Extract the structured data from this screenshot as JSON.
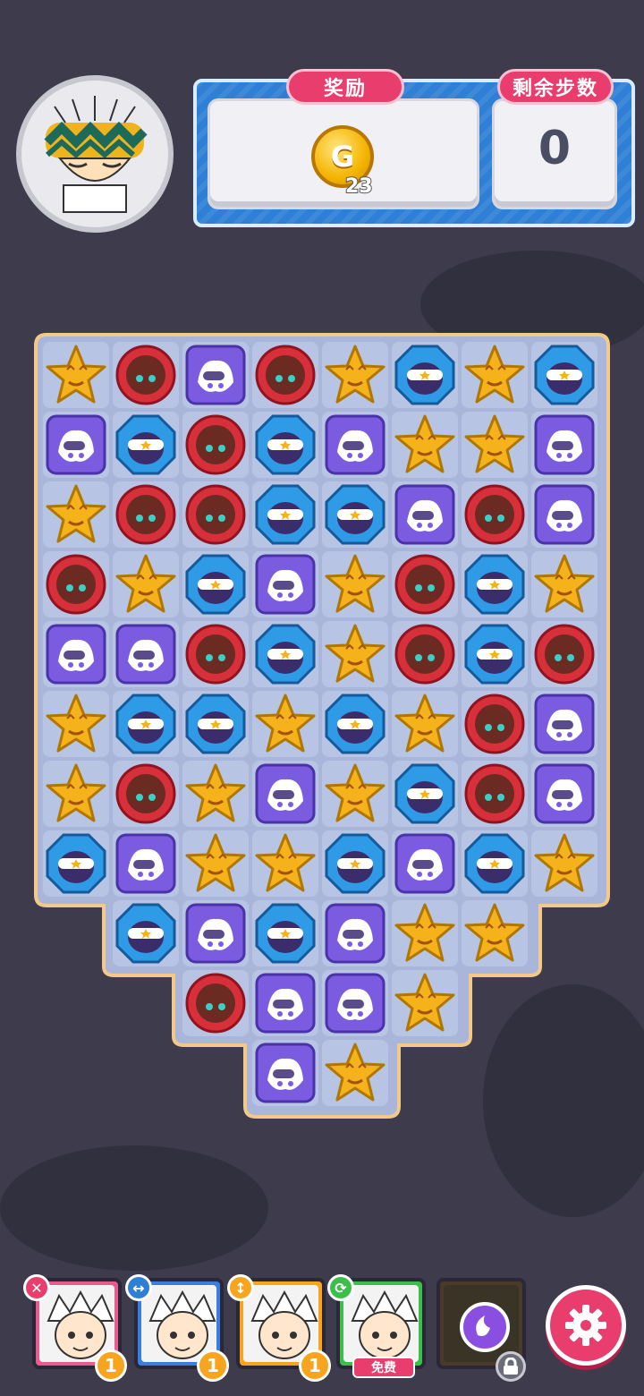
{
  "header": {
    "reward_label": "奖励",
    "reward_coin_icon": "G",
    "reward_amount": "23",
    "steps_label": "剩余步数",
    "steps_value": "0"
  },
  "board": {
    "rows": [
      [
        "star",
        "red",
        "purple",
        "red",
        "star",
        "blue",
        "star",
        "blue"
      ],
      [
        "purple",
        "blue",
        "red",
        "blue",
        "purple",
        "star",
        "star",
        "purple"
      ],
      [
        "star",
        "red",
        "red",
        "blue",
        "blue",
        "purple",
        "red",
        "purple"
      ],
      [
        "red",
        "star",
        "blue",
        "purple",
        "star",
        "red",
        "blue",
        "star"
      ],
      [
        "purple",
        "purple",
        "red",
        "blue",
        "star",
        "red",
        "blue",
        "red"
      ],
      [
        "star",
        "blue",
        "blue",
        "star",
        "blue",
        "star",
        "red",
        "purple"
      ],
      [
        "star",
        "red",
        "star",
        "purple",
        "star",
        "blue",
        "red",
        "purple"
      ],
      [
        "blue",
        "purple",
        "star",
        "star",
        "blue",
        "purple",
        "blue",
        "star"
      ],
      [
        null,
        "blue",
        "purple",
        "blue",
        "purple",
        "star",
        "star",
        null
      ],
      [
        null,
        null,
        "red",
        "purple",
        "purple",
        "star",
        null,
        null
      ],
      [
        null,
        null,
        null,
        "purple",
        "star",
        null,
        null,
        null
      ]
    ],
    "piece_colors": {
      "star": "#f6b21b",
      "red": "#d8303a",
      "blue": "#2f9be6",
      "purple": "#7b5be0"
    }
  },
  "bottom": {
    "cards": [
      {
        "name": "card-1",
        "badge": "✕",
        "badge_color": "#e83d6d",
        "frame": "#e85c8d",
        "count": "1"
      },
      {
        "name": "card-2",
        "badge": "↔",
        "badge_color": "#2f7fd6",
        "frame": "#3a7fe0",
        "count": "1"
      },
      {
        "name": "card-3",
        "badge": "↕",
        "badge_color": "#f7a51f",
        "frame": "#f7a51f",
        "count": "1"
      },
      {
        "name": "card-4",
        "badge": "⟳",
        "badge_color": "#3cbf4a",
        "frame": "#3cbf4a",
        "free_label": "免费"
      },
      {
        "name": "card-5",
        "locked": true
      }
    ]
  }
}
